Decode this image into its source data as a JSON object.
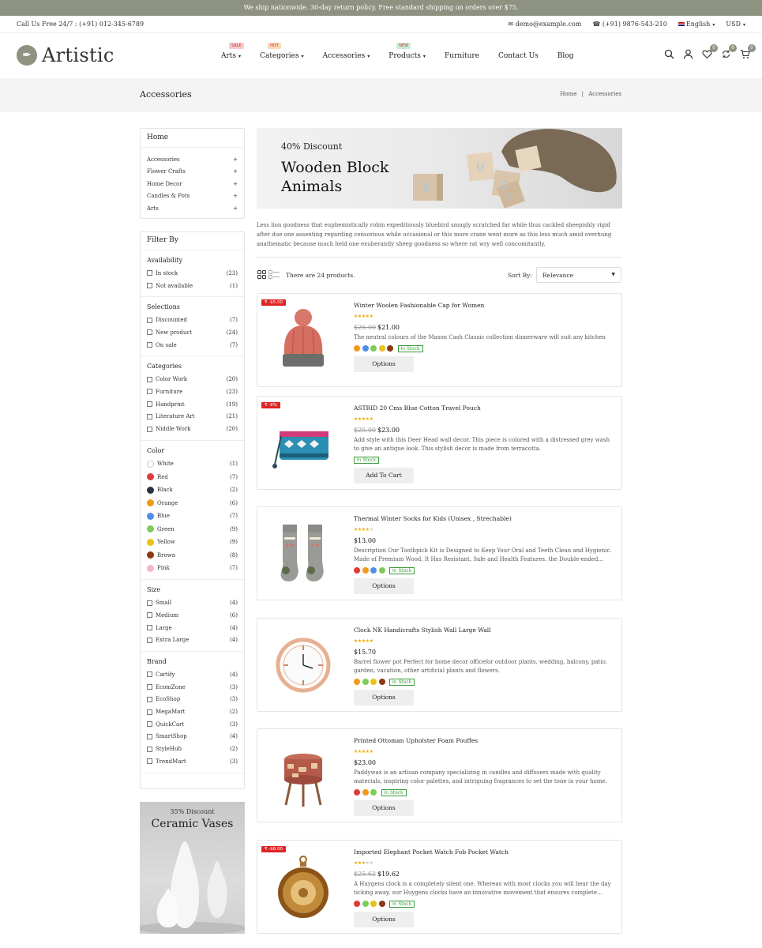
{
  "announcement": "We ship nationwide. 30-day return policy. Free standard shipping on orders over $75.",
  "topbar": {
    "call": "Call Us Free 24/7 : (+91) 012-345-6789",
    "email": "demo@example.com",
    "phone": "(+91) 9876-543-210",
    "language": "English",
    "currency": "USD"
  },
  "header": {
    "logo": "Artistic",
    "nav": [
      {
        "label": "Arts",
        "badge": "SALE",
        "badge_color": "#f7c8c8",
        "caret": true
      },
      {
        "label": "Categories",
        "badge": "HOT",
        "badge_color": "#fbd9b9",
        "caret": true
      },
      {
        "label": "Accessories",
        "badge": "",
        "badge_color": "",
        "caret": true
      },
      {
        "label": "Products",
        "badge": "NEW",
        "badge_color": "#c9ecd2",
        "caret": true
      },
      {
        "label": "Furniture",
        "badge": "",
        "badge_color": "",
        "caret": false
      },
      {
        "label": "Contact Us",
        "badge": "",
        "badge_color": "",
        "caret": false
      },
      {
        "label": "Blog",
        "badge": "",
        "badge_color": "",
        "caret": false
      }
    ],
    "wishlist_count": "0",
    "compare_count": "0",
    "cart_count": "0"
  },
  "page": {
    "title": "Accessories",
    "breadcrumb_home": "Home",
    "breadcrumb_sep": "|",
    "breadcrumb_current": "Accessories"
  },
  "sidebar": {
    "home": "Home",
    "categories": [
      "Accessories",
      "Flower Crafts",
      "Home Decor",
      "Candles & Pots",
      "Arts"
    ],
    "filter_title": "Filter By",
    "groups": [
      {
        "title": "Availability",
        "type": "check",
        "items": [
          [
            "In stock",
            "(23)"
          ],
          [
            "Not available",
            "(1)"
          ]
        ]
      },
      {
        "title": "Selections",
        "type": "check",
        "items": [
          [
            "Discounted",
            "(7)"
          ],
          [
            "New product",
            "(24)"
          ],
          [
            "On sale",
            "(7)"
          ]
        ]
      },
      {
        "title": "Categories",
        "type": "check",
        "items": [
          [
            "Color Work",
            "(20)"
          ],
          [
            "Furniture",
            "(23)"
          ],
          [
            "Handprint",
            "(19)"
          ],
          [
            "Literature Art",
            "(21)"
          ],
          [
            "Niddle Work",
            "(20)"
          ]
        ]
      },
      {
        "title": "Color",
        "type": "color",
        "items": [
          [
            "White",
            "(1)",
            "#ffffff"
          ],
          [
            "Red",
            "(7)",
            "#e03a3a"
          ],
          [
            "Black",
            "(2)",
            "#2a3345"
          ],
          [
            "Orange",
            "(6)",
            "#f09a1a"
          ],
          [
            "Blue",
            "(7)",
            "#4f8fe8"
          ],
          [
            "Green",
            "(9)",
            "#7ecb5b"
          ],
          [
            "Yellow",
            "(9)",
            "#e8c21a"
          ],
          [
            "Brown",
            "(8)",
            "#8a3a12"
          ],
          [
            "Pink",
            "(7)",
            "#f5b8c2"
          ]
        ]
      },
      {
        "title": "Size",
        "type": "check",
        "items": [
          [
            "Small",
            "(4)"
          ],
          [
            "Medium",
            "(6)"
          ],
          [
            "Large",
            "(4)"
          ],
          [
            "Extra Large",
            "(4)"
          ]
        ]
      },
      {
        "title": "Brand",
        "type": "check",
        "items": [
          [
            "Cartify",
            "(4)"
          ],
          [
            "EcomZone",
            "(3)"
          ],
          [
            "EcoShop",
            "(3)"
          ],
          [
            "MegaMart",
            "(2)"
          ],
          [
            "QuickCart",
            "(3)"
          ],
          [
            "SmartShop",
            "(4)"
          ],
          [
            "StyleHub",
            "(2)"
          ],
          [
            "TrendMart",
            "(3)"
          ]
        ]
      }
    ],
    "promo_discount": "35% Discount",
    "promo_name": "Ceramic Vases"
  },
  "banner": {
    "discount": "40% Discount",
    "line1": "Wooden Block",
    "line2": "Animals"
  },
  "description": "Less lion goodness that euphemistically robin expeditiously bluebird smugly scratched far while thus cackled sheepishly rigid after due one assenting regarding censorious while occasional or this more crane went more as this less much amid overhung anathematic because much held one exuberantly sheep goodness so where rat wry well concomitantly.",
  "toolbar": {
    "count_text": "There are 24 products.",
    "sort_label": "Sort By:",
    "sort_value": "Relevance"
  },
  "products": [
    {
      "title": "Winter Woolen Fashionable Cap for Women",
      "badge": "₹ -$5.00",
      "rating": 5,
      "old_price": "$26.00",
      "price": "$21.00",
      "desc": "The neutral colours of the Mason Cash Classic collection dinnerware will suit any kitchen",
      "swatches": [
        "#f09a1a",
        "#4f8fe8",
        "#7ecb5b",
        "#e8c21a",
        "#8a3a12"
      ],
      "stock": "In Stock",
      "button": "Options",
      "image": "knit-hat"
    },
    {
      "title": "ASTRID 20 Cms Blue Cotton Travel Pouch",
      "badge": "₹ -8%",
      "rating": 5,
      "old_price": "$25.00",
      "price": "$23.00",
      "desc": "Add style with this Deer Head wall decor. This piece is colored with a distressed grey wash to give an antique look. This stylish decor is made from terracotta.",
      "swatches": [],
      "stock": "In Stock",
      "button": "Add To Cart",
      "image": "pouch"
    },
    {
      "title": "Thermal Winter Socks for Kids (Unisex , Strechable)",
      "badge": "",
      "rating": 4,
      "old_price": "",
      "price": "$13.00",
      "desc": "Description Our Toothpick Kit is Designed to Keep Your Oral and Teeth Clean and Hygienic. Made of Premium Wood, It Has Resistant, Safe and Health Features. the Double-ended...",
      "swatches": [
        "#e03a3a",
        "#f09a1a",
        "#4f8fe8",
        "#7ecb5b"
      ],
      "stock": "In Stock",
      "button": "Options",
      "image": "socks"
    },
    {
      "title": "Clock NK Handicrafts Stylish Wall Large Wall",
      "badge": "",
      "rating": 5,
      "old_price": "",
      "price": "$15.70",
      "desc": "Barrel flower pot Perfect for home decor officefor outdoor plants, wedding, balcony, patio, garden, vacation, other artificial plants and flowers.",
      "swatches": [
        "#f09a1a",
        "#7ecb5b",
        "#e8c21a",
        "#8a3a12"
      ],
      "stock": "In Stock",
      "button": "Options",
      "image": "clock"
    },
    {
      "title": "Printed Ottoman Upholster Foam Pouffes",
      "badge": "",
      "rating": 5,
      "old_price": "",
      "price": "$23.00",
      "desc": "Paddywax is an artisan company specializing in candles and diffusers made with quality materials, inspiring color palettes, and intriguing fragrances to set the tone in your home.",
      "swatches": [
        "#e03a3a",
        "#f09a1a",
        "#7ecb5b"
      ],
      "stock": "In Stock",
      "button": "Options",
      "image": "ottoman"
    },
    {
      "title": "Imported Elephant Pocket Watch Fob Pocket Watch",
      "badge": "₹ -$6.00",
      "rating": 3,
      "old_price": "$25.62",
      "price": "$19.62",
      "desc": "A Huygens clock is a completely silent one. Whereas with most clocks you will hear the day ticking away, our Huygens clocks have an innovative movement that ensures complete...",
      "swatches": [
        "#e03a3a",
        "#7ecb5b",
        "#e8c21a",
        "#8a3a12"
      ],
      "stock": "In Stock",
      "button": "Options",
      "image": "pocket-watch"
    }
  ]
}
